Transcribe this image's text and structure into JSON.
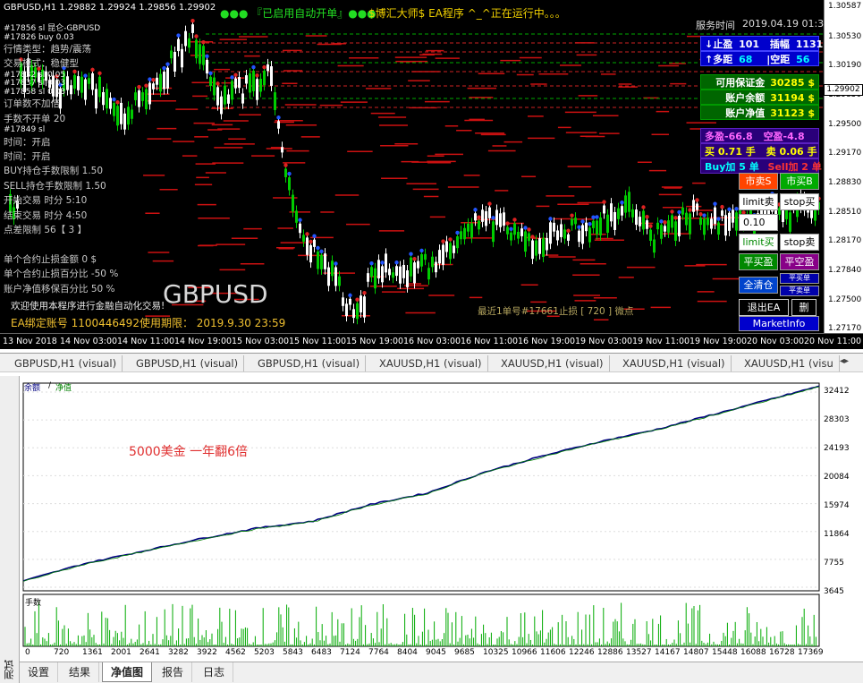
{
  "top_chart": {
    "symbol_info": "GBPUSD,H1  1.29882 1.29924 1.29856 1.29902",
    "auto_status": "●●● 『已启用自动开单』●●●",
    "ea_status": "$博汇大师$ EA程序 ^_^正在运行中。。。",
    "server_time_label": "服务时间",
    "server_time_value": "2019.04.19 01:32",
    "big_symbol": "GBPUSD",
    "welcome": "欢迎使用本程序进行金融自动化交易!",
    "account_line": "EA绑定账号 1100446492使用期限： 2019.9.30 23:59",
    "recent_line": "最近1单号#17661止损 [ 720 ] 微点",
    "colors": {
      "background": "#000000",
      "bull": "#00cc00",
      "bear": "#ffffff",
      "level": "#cc1111"
    },
    "left_info": [
      {
        "text": "#17856 sl 昆仑-GBPUSD",
        "small": true
      },
      {
        "text": "#17826 buy 0.03",
        "small": true
      },
      {
        "text": "行情类型：趋势/震荡",
        "small": false
      },
      {
        "text": "交易模式：稳健型",
        "small": false
      },
      {
        "text": "#17832 sl 0.05",
        "small": true
      },
      {
        "text": "#17837 sl 0.03",
        "small": true
      },
      {
        "text": "#17858 sl 0.03",
        "small": true
      },
      {
        "text": "订单数不加倍",
        "small": false
      },
      {
        "text": "手数不开单 20",
        "small": false
      },
      {
        "text": "#17849 sl",
        "small": true
      },
      {
        "text": "时间：开启",
        "small": false
      },
      {
        "text": "时间：开启",
        "small": false
      },
      {
        "text": "BUY持仓手数限制 1.50",
        "small": false
      },
      {
        "text": "SELL持仓手数限制 1.50",
        "small": false
      },
      {
        "text": "开始交易 时分 5:10",
        "small": false
      },
      {
        "text": "结束交易 时分 4:50",
        "small": false
      },
      {
        "text": "点差限制 56【 3 】",
        "small": false
      },
      {
        "text": "",
        "small": false
      },
      {
        "text": "单个合约止损金额 0 $",
        "small": false
      },
      {
        "text": "单个合约止损百分比 -50 %",
        "small": false
      },
      {
        "text": "账户净值移保百分比 50 %",
        "small": false
      }
    ],
    "price_axis": [
      "1.30587",
      "1.30530",
      "1.30190",
      "1.29850",
      "1.29500",
      "1.29170",
      "1.28830",
      "1.28510",
      "1.28170",
      "1.27840",
      "1.27500",
      "1.27170"
    ],
    "current_price": "1.29902",
    "time_axis": [
      "13 Nov 2018",
      "14 Nov 03:00",
      "14 Nov 11:00",
      "14 Nov 19:00",
      "15 Nov 03:00",
      "15 Nov 11:00",
      "15 Nov 19:00",
      "16 Nov 03:00",
      "16 Nov 11:00",
      "16 Nov 19:00",
      "19 Nov 03:00",
      "19 Nov 11:00",
      "19 Nov 19:00",
      "20 Nov 03:00",
      "20 Nov 11:00"
    ],
    "panel": {
      "row1": {
        "a_label": "↓止盈",
        "a_value": "101",
        "b_label": "插幅",
        "b_value": "1131"
      },
      "row2": {
        "a_label": "↑多距",
        "a_value": "68",
        "b_label": "|空距",
        "b_value": "56"
      },
      "margin_label": "可用保证金",
      "margin_value": "30285 $",
      "balance_label": "账户余额",
      "balance_value": "31194 $",
      "equity_label": "账户净值",
      "equity_value": "31123 $",
      "p1": {
        "a": "多盈-66.8",
        "b": "空盈-4.8"
      },
      "p2": {
        "a": "买 0.71 手",
        "b": "卖 0.06 手"
      },
      "p3": {
        "a": "Buy加 5 单",
        "b": "Sell加 2 单"
      }
    },
    "buttons": {
      "market_sell": "市卖S",
      "market_buy": "市买B",
      "limit_sell": "limit卖",
      "stop_buy": "stop买",
      "lot_value": "0.10",
      "limit_buy": "limit买",
      "stop_sell": "stop卖",
      "close_buy": "平买盈",
      "close_sell": "平空盈",
      "close_all": "全清仓",
      "small_1": "平买单",
      "small_2": "平卖单",
      "exit_ea": "退出EA",
      "delete": "删",
      "market_info": "MarketInfo"
    }
  },
  "chart_tabs": [
    "GBPUSD,H1 (visual)",
    "GBPUSD,H1 (visual)",
    "GBPUSD,H1 (visual)",
    "XAUUSD,H1 (visual)",
    "XAUUSD,H1 (visual)",
    "XAUUSD,H1 (visual)",
    "XAUUSD,H1 (visu"
  ],
  "tester": {
    "side_label": "测试",
    "note": "5000美金  一年翻6倍",
    "legend_balance": "余额",
    "legend_slash": "/",
    "legend_equity": "净值",
    "lots_label": "手数",
    "y_ticks": [
      "32412",
      "28303",
      "24193",
      "20084",
      "15974",
      "11864",
      "7755",
      "3645"
    ],
    "x_ticks": [
      "0",
      "720",
      "1361",
      "2001",
      "2641",
      "3282",
      "3922",
      "4562",
      "5203",
      "5843",
      "6483",
      "7124",
      "7764",
      "8404",
      "9045",
      "9685",
      "10325",
      "10966",
      "11606",
      "12246",
      "12886",
      "13527",
      "14167",
      "14807",
      "15448",
      "16088",
      "16728",
      "17369"
    ],
    "colors": {
      "balance": "#000080",
      "equity": "#008000",
      "lots": "#00aa00"
    }
  },
  "bottom_tabs": [
    "设置",
    "结果",
    "净值图",
    "报告",
    "日志"
  ],
  "active_bottom_tab": 2,
  "chart_data": {
    "type": "line",
    "title": "",
    "xlabel": "",
    "ylabel": "",
    "x_range": [
      0,
      17369
    ],
    "ylim": [
      3645,
      32412
    ],
    "series": [
      {
        "name": "余额",
        "x": [
          0,
          1361,
          2641,
          3922,
          5203,
          6483,
          7764,
          9045,
          10325,
          11606,
          12886,
          14167,
          15448,
          16728,
          17800
        ],
        "y": [
          5000,
          7400,
          9100,
          10800,
          12300,
          13300,
          15600,
          17200,
          20100,
          22300,
          24300,
          26000,
          28100,
          30200,
          32000
        ]
      },
      {
        "name": "净值",
        "x": [
          0,
          1361,
          2641,
          3922,
          5203,
          6483,
          7764,
          9045,
          10325,
          11606,
          12886,
          14167,
          15448,
          16728,
          17800
        ],
        "y": [
          4950,
          7300,
          9000,
          10700,
          12200,
          13200,
          15500,
          17100,
          20000,
          22200,
          24200,
          25900,
          28000,
          30100,
          31900
        ]
      }
    ]
  }
}
